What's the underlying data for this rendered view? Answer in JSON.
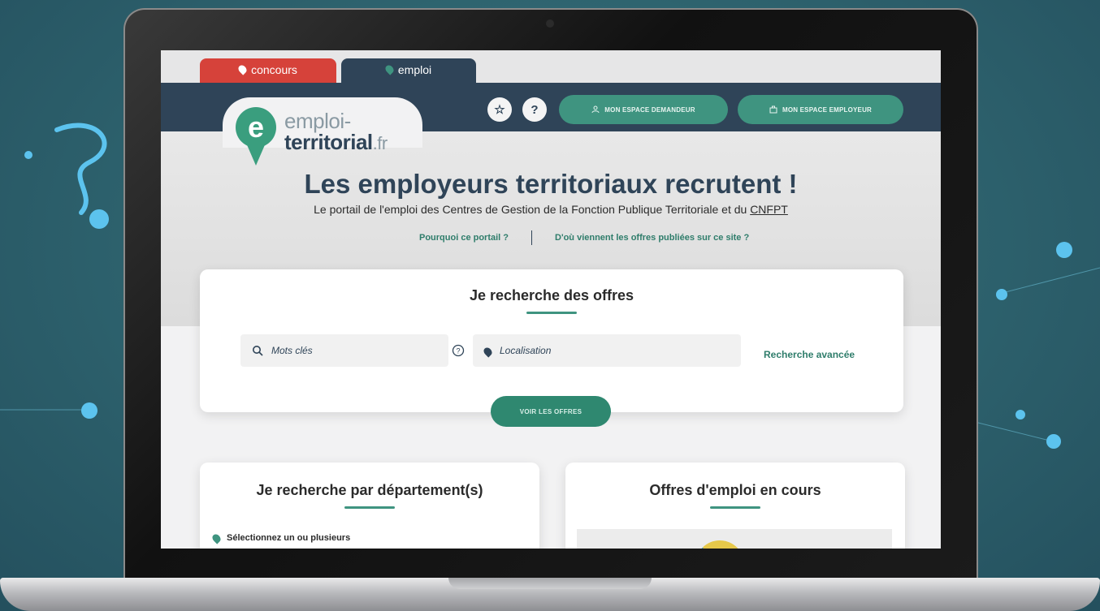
{
  "tabs": {
    "concours_label": "concours",
    "emploi_label": "emploi"
  },
  "header": {
    "favorite_label": "☆",
    "help_label": "?",
    "demandeur_label": "MON ESPACE DEMANDEUR",
    "employeur_label": "MON ESPACE EMPLOYEUR"
  },
  "logo": {
    "line1": "emploi-",
    "line2": "territorial",
    "suffix": ".fr",
    "mark": "e"
  },
  "hero": {
    "title": "Les employeurs territoriaux recrutent !",
    "subtitle": "Le portail de l'emploi des Centres de Gestion de la Fonction Publique Territoriale et du ",
    "subtitle_link": "CNFPT",
    "link_pourquoi": "Pourquoi ce portail ?",
    "link_origine": "D'où viennent les offres publiées sur ce site ?"
  },
  "search": {
    "title": "Je recherche des offres",
    "keywords_placeholder": "Mots clés",
    "location_placeholder": "Localisation",
    "advanced_label": "Recherche avancée",
    "submit_label": "VOIR LES OFFRES"
  },
  "departement": {
    "title": "Je recherche par département(s)",
    "select_label": "Sélectionnez un ou plusieurs"
  },
  "offres": {
    "title": "Offres d'emploi en cours"
  },
  "colors": {
    "concours_red": "#d6423a",
    "navy": "#2f4458",
    "teal": "#3f9480",
    "background_teal": "#2f6570"
  },
  "icons": [
    "star-icon",
    "question-icon",
    "user-icon",
    "briefcase-icon",
    "search-icon",
    "help-circle-icon",
    "location-pin-icon"
  ]
}
